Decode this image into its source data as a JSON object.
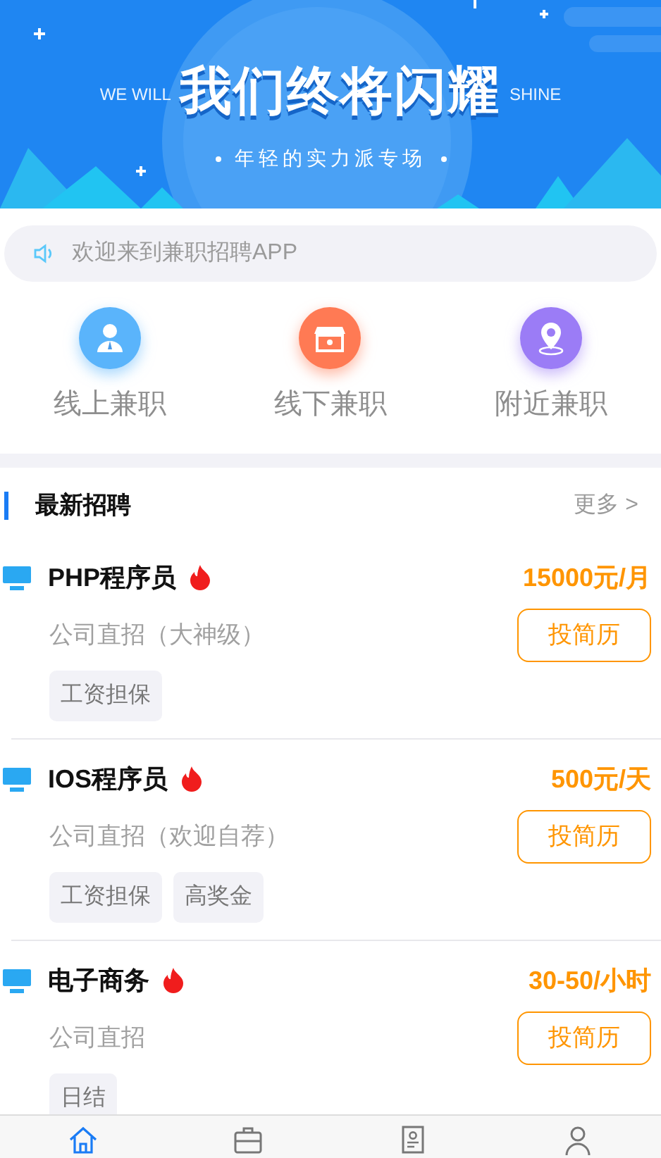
{
  "banner": {
    "title": "我们终将闪耀",
    "left_caption": "WE WILL",
    "right_caption": "SHINE",
    "subtitle": "年轻的实力派专场"
  },
  "notice": {
    "text": "欢迎来到兼职招聘APP"
  },
  "categories": [
    {
      "label": "线上兼职",
      "kind": "person",
      "color": "#5ab4fb"
    },
    {
      "label": "线下兼职",
      "kind": "store",
      "color": "#ff7a54"
    },
    {
      "label": "附近兼职",
      "kind": "location",
      "color": "#9b7cf6"
    }
  ],
  "section": {
    "title": "最新招聘",
    "more": "更多 >"
  },
  "jobs": [
    {
      "title": "PHP程序员",
      "hot": true,
      "salary": "15000元/月",
      "company": "公司直招（大神级）",
      "button": "投简历",
      "tags": [
        "工资担保"
      ]
    },
    {
      "title": "IOS程序员",
      "hot": true,
      "salary": "500元/天",
      "company": "公司直招（欢迎自荐）",
      "button": "投简历",
      "tags": [
        "工资担保",
        "高奖金"
      ]
    },
    {
      "title": "电子商务",
      "hot": true,
      "salary": "30-50/小时",
      "company": "公司直招",
      "button": "投简历",
      "tags": [
        "日结"
      ]
    }
  ],
  "tab_bar": [
    {
      "kind": "home",
      "selected": true
    },
    {
      "kind": "briefcase",
      "selected": false
    },
    {
      "kind": "resume",
      "selected": false
    },
    {
      "kind": "person",
      "selected": false
    }
  ]
}
